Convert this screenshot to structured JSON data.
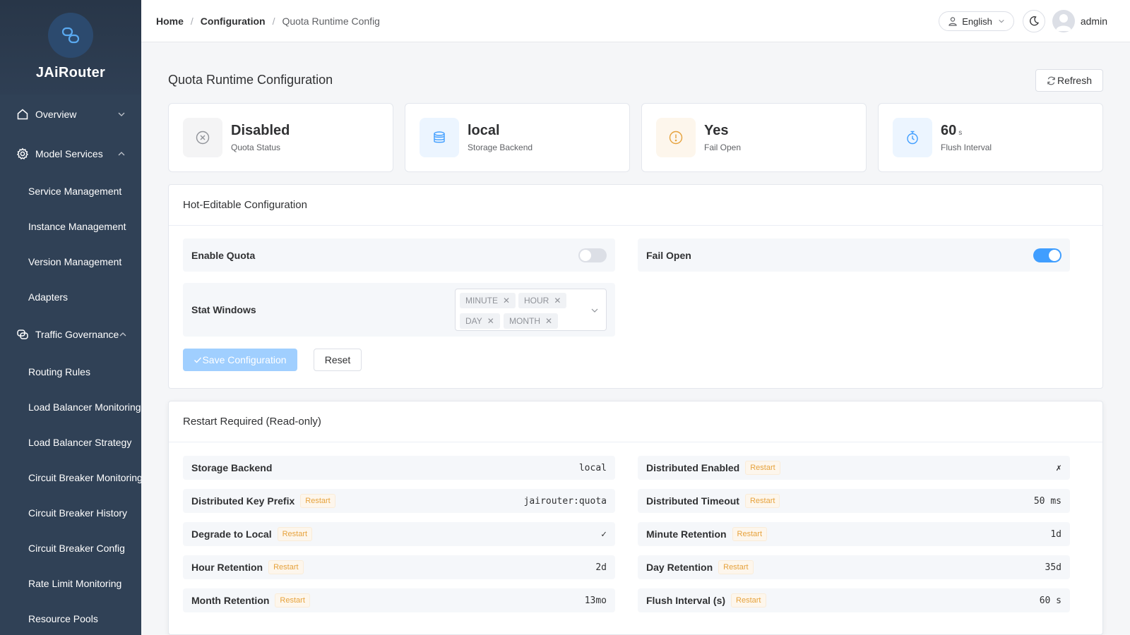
{
  "brand": {
    "name": "JAiRouter"
  },
  "sidebar": {
    "overview": "Overview",
    "model_services": "Model Services",
    "model_items": [
      "Service Management",
      "Instance Management",
      "Version Management",
      "Adapters"
    ],
    "traffic_governance": "Traffic Governance",
    "traffic_items": [
      "Routing Rules",
      "Load Balancer Monitoring",
      "Load Balancer Strategy",
      "Circuit Breaker Monitoring",
      "Circuit Breaker History",
      "Circuit Breaker Config",
      "Rate Limit Monitoring",
      "Resource Pools"
    ]
  },
  "header": {
    "breadcrumb": [
      "Home",
      "Configuration",
      "Quota Runtime Config"
    ],
    "separator": "/",
    "language": "English",
    "user": "admin"
  },
  "page": {
    "title": "Quota Runtime Configuration",
    "refresh_label": "Refresh"
  },
  "stats": [
    {
      "value": "Disabled",
      "unit": "",
      "label": "Quota Status",
      "icon": "circle-x-icon",
      "color": "#909399",
      "bg": "#f4f4f5"
    },
    {
      "value": "local",
      "unit": "",
      "label": "Storage Backend",
      "icon": "database-icon",
      "color": "#409eff",
      "bg": "#ecf5ff"
    },
    {
      "value": "Yes",
      "unit": "",
      "label": "Fail Open",
      "icon": "warning-icon",
      "color": "#e6a23c",
      "bg": "#fdf6ec"
    },
    {
      "value": "60",
      "unit": "s",
      "label": "Flush Interval",
      "icon": "timer-icon",
      "color": "#409eff",
      "bg": "#ecf5ff"
    }
  ],
  "hot": {
    "title": "Hot-Editable Configuration",
    "enable_quota": {
      "label": "Enable Quota",
      "on": false
    },
    "fail_open": {
      "label": "Fail Open",
      "on": true
    },
    "stat_windows": {
      "label": "Stat Windows",
      "tags": [
        "MINUTE",
        "HOUR",
        "DAY",
        "MONTH"
      ]
    },
    "save_label": "Save Configuration",
    "reset_label": "Reset"
  },
  "readonly": {
    "title": "Restart Required (Read-only)",
    "restart_badge": "Restart",
    "left": [
      {
        "label": "Storage Backend",
        "badge": false,
        "value": "local"
      },
      {
        "label": "Distributed Key Prefix",
        "badge": true,
        "value": "jairouter:quota"
      },
      {
        "label": "Degrade to Local",
        "badge": true,
        "value": "✓"
      },
      {
        "label": "Hour Retention",
        "badge": true,
        "value": "2d"
      },
      {
        "label": "Month Retention",
        "badge": true,
        "value": "13mo"
      }
    ],
    "right": [
      {
        "label": "Distributed Enabled",
        "badge": true,
        "value": "✗"
      },
      {
        "label": "Distributed Timeout",
        "badge": true,
        "value": "50 ms"
      },
      {
        "label": "Minute Retention",
        "badge": true,
        "value": "1d"
      },
      {
        "label": "Day Retention",
        "badge": true,
        "value": "35d"
      },
      {
        "label": "Flush Interval (s)",
        "badge": true,
        "value": "60 s"
      }
    ]
  }
}
